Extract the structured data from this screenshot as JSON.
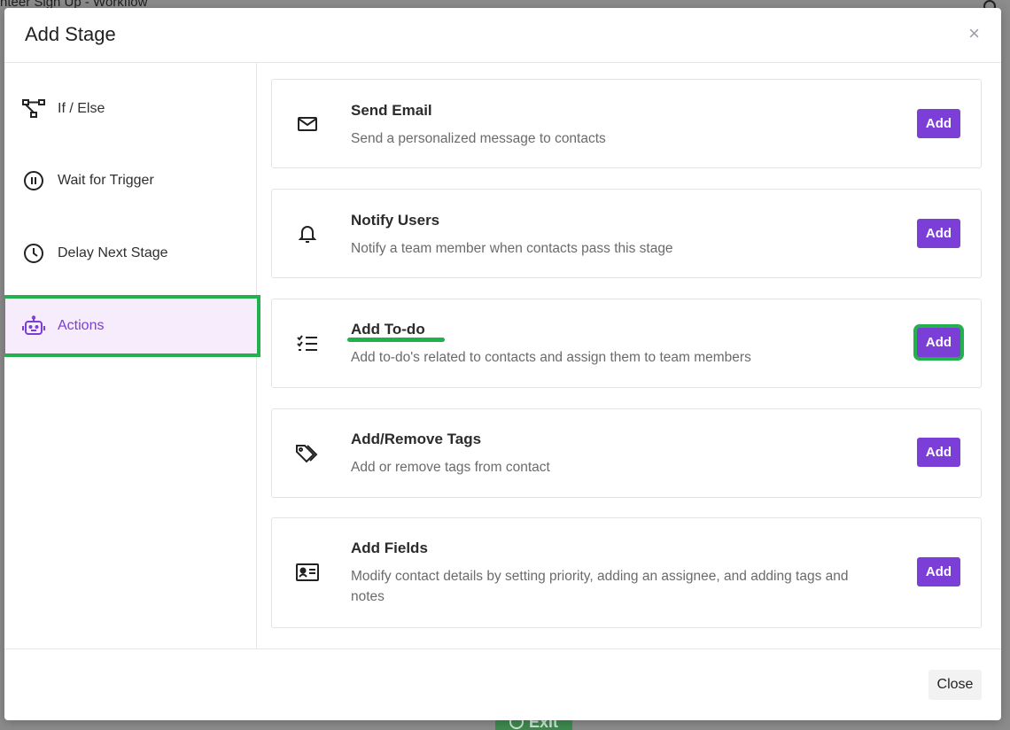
{
  "background": {
    "title": "nteer Sign Up - Workflow",
    "exit_label": "Exit"
  },
  "modal": {
    "title": "Add Stage",
    "close_icon": "×"
  },
  "sidebar": {
    "items": [
      {
        "label": "If / Else",
        "icon": "branch-icon"
      },
      {
        "label": "Wait for Trigger",
        "icon": "pause-circle-icon"
      },
      {
        "label": "Delay Next Stage",
        "icon": "clock-icon"
      },
      {
        "label": "Actions",
        "icon": "robot-icon",
        "active": true
      }
    ]
  },
  "actions": [
    {
      "title": "Send Email",
      "description": "Send a personalized message to contacts",
      "icon": "envelope-icon",
      "button": "Add"
    },
    {
      "title": "Notify Users",
      "description": "Notify a team member when contacts pass this stage",
      "icon": "bell-icon",
      "button": "Add"
    },
    {
      "title": "Add To-do",
      "description": "Add to-do's related to contacts and assign them to team members",
      "icon": "checklist-icon",
      "button": "Add"
    },
    {
      "title": "Add/Remove Tags",
      "description": "Add or remove tags from contact",
      "icon": "tags-icon",
      "button": "Add"
    },
    {
      "title": "Add Fields",
      "description": "Modify contact details by setting priority, adding an assignee, and adding tags and notes",
      "icon": "id-card-icon",
      "button": "Add"
    }
  ],
  "footer": {
    "close_label": "Close"
  },
  "colors": {
    "accent": "#7b3fd8",
    "highlight": "#22b14c",
    "active_bg": "#f6ecfb"
  }
}
